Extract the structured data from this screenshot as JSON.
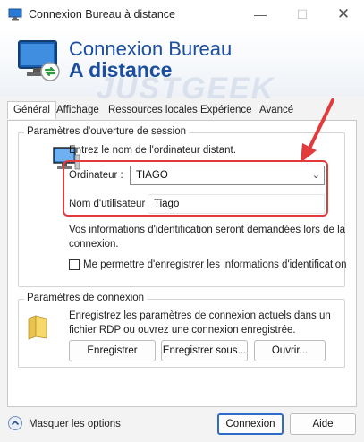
{
  "window": {
    "title": "Connexion Bureau à distance",
    "minimize": "—",
    "maximize": "☐",
    "close": "✕"
  },
  "banner": {
    "line1": "Connexion Bureau",
    "line2": "A distance",
    "watermark_a": "JUST",
    "watermark_b": "GEEK"
  },
  "tabs": [
    {
      "label": "Général",
      "active": true
    },
    {
      "label": "Affichage"
    },
    {
      "label": "Ressources locales"
    },
    {
      "label": "Expérience"
    },
    {
      "label": "Avancé"
    }
  ],
  "session_group": {
    "legend": "Paramètres d'ouverture de session",
    "intro": "Entrez le nom de l'ordinateur distant.",
    "computer_label": "Ordinateur :",
    "computer_value": "TIAGO",
    "username_label": "Nom d'utilisateur :",
    "username_value": "Tiago",
    "info_line1": "Vos informations d'identification seront demandées lors de la",
    "info_line2": "connexion.",
    "remember_label": "Me permettre d'enregistrer les informations d'identification",
    "remember_checked": false
  },
  "connection_group": {
    "legend": "Paramètres de connexion",
    "desc_line1": "Enregistrez les paramètres de connexion actuels dans un",
    "desc_line2": "fichier RDP ou ouvrez une connexion enregistrée.",
    "save_button": "Enregistrer",
    "save_as_button": "Enregistrer sous...",
    "open_button": "Ouvrir..."
  },
  "footer": {
    "hide_options": "Masquer les options",
    "connect_button": "Connexion",
    "help_button": "Aide"
  },
  "colors": {
    "accent": "#1d4fa0",
    "highlight": "#e23b3b",
    "primary_button_border": "#2f6bc9"
  }
}
